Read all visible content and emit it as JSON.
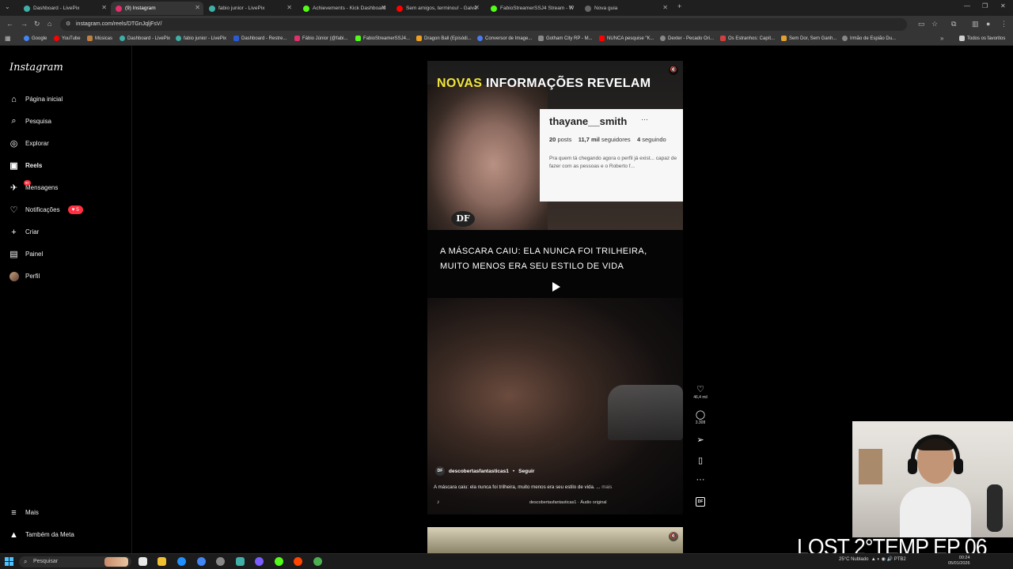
{
  "browser": {
    "tabs": [
      {
        "label": "Dashboard - LivePix",
        "color": "#3fb0a8"
      },
      {
        "label": "(9) Instagram",
        "color": "#e1306c",
        "active": true
      },
      {
        "label": "fabio junior - LivePix",
        "color": "#3fb0a8"
      },
      {
        "label": "Achievements - Kick Dashboard",
        "color": "#53fc18"
      },
      {
        "label": "Sem amigos, terminou! - Galvã",
        "color": "#ff0000"
      },
      {
        "label": "FabioStreamerSSJ4 Stream - W",
        "color": "#53fc18"
      },
      {
        "label": "Nova guia",
        "color": "#888888"
      }
    ],
    "new_tab": "+",
    "url": "instagram.com/reels/DTGnJqljFsV/",
    "bookmarks": [
      {
        "label": "Google",
        "color": "#4285f4"
      },
      {
        "label": "YouTube",
        "color": "#ff0000"
      },
      {
        "label": "Músicas",
        "color": "#c08040"
      },
      {
        "label": "Dashboard - LivePix",
        "color": "#3fb0a8"
      },
      {
        "label": "fabio junior - LivePix",
        "color": "#3fb0a8"
      },
      {
        "label": "Dashboard - Restre...",
        "color": "#2a5bd7"
      },
      {
        "label": "Fábio Júnior (@fabi...",
        "color": "#e1306c"
      },
      {
        "label": "FabioStreamerSSJ4...",
        "color": "#53fc18"
      },
      {
        "label": "Dragon Ball (Episódi...",
        "color": "#f0a020"
      },
      {
        "label": "Conversor de Image...",
        "color": "#4c7cf0"
      },
      {
        "label": "Gotham City RP - M...",
        "color": "#888888"
      },
      {
        "label": "NUNCA pesquise \"K...",
        "color": "#ff0000"
      },
      {
        "label": "Dexter - Pecado Ori...",
        "color": "#888888"
      },
      {
        "label": "Os Estranhos: Capít...",
        "color": "#d04040"
      },
      {
        "label": "Sem Dor, Sem Ganh...",
        "color": "#e0a030"
      },
      {
        "label": "Irmão de Espião Du...",
        "color": "#888888"
      }
    ],
    "all_favorites": "Todos os favoritos"
  },
  "instagram": {
    "logo": "Instagram",
    "nav": [
      {
        "label": "Página inicial",
        "icon": "home-icon",
        "glyph": "⌂"
      },
      {
        "label": "Pesquisa",
        "icon": "search-icon",
        "glyph": "⌕"
      },
      {
        "label": "Explorar",
        "icon": "compass-icon",
        "glyph": "◎"
      },
      {
        "label": "Reels",
        "icon": "reels-icon",
        "glyph": "▣"
      },
      {
        "label": "Mensagens",
        "icon": "messenger-icon",
        "glyph": "✈"
      },
      {
        "label": "Notificações",
        "icon": "heart-icon",
        "glyph": "♡"
      },
      {
        "label": "Criar",
        "icon": "plus-icon",
        "glyph": "+"
      },
      {
        "label": "Painel",
        "icon": "dashboard-icon",
        "glyph": "▤"
      },
      {
        "label": "Perfil",
        "icon": "avatar",
        "glyph": "●"
      }
    ],
    "messages_badge": "9+",
    "notifications_badge": "♥ 5",
    "more": "Mais",
    "meta": "Também da Meta"
  },
  "reel": {
    "headline_yellow": "NOVAS",
    "headline_white": "INFORMAÇÕES REVELAM",
    "profile_card": {
      "username": "thayane__smith",
      "dots": "···",
      "posts": "20",
      "posts_label": "posts",
      "followers": "11,7 mil",
      "followers_label": "seguidores",
      "following": "4",
      "following_label": "seguindo",
      "bio": "Pra quem tá chegando agora o perfil já exist... capaz de fazer com as pessoas e o Roberto f..."
    },
    "df_logo": "DF",
    "caption_overlay": "A MÁSCARA CAIU: ELA NUNCA FOI TRILHEIRA, MUITO MENOS ERA SEU ESTILO DE VIDA",
    "author": "descobertasfantasticas1",
    "author_avatar": "DF",
    "separator": "•",
    "follow": "Seguir",
    "caption": "A máscara caiu: ela nunca foi trilheira, muito menos era seu estilo de vida. ...",
    "caption_more": "mais",
    "audio": "descobertasfantasticas1 · Áudio original",
    "audio_icon": "♪",
    "mute_icon": "🔇"
  },
  "actions": {
    "likes": "46,4 mil",
    "comments": "3.308",
    "more": "···",
    "audio_thumb": "DF"
  },
  "overlay": {
    "episode": "LOST 2°TEMP EP 06"
  },
  "taskbar": {
    "search": "Pesquisar",
    "weather": "25°C  Nublado",
    "time": "00:24",
    "date": "05/01/2026",
    "lang": "PTB2",
    "icon_colors": [
      "#e8e8e8",
      "#f0c030",
      "#4285f4",
      "#1e90ff",
      "#3fb0a8",
      "#888888",
      "#7a5cff",
      "#53fc18",
      "#ff4500",
      "#4caf50"
    ]
  }
}
